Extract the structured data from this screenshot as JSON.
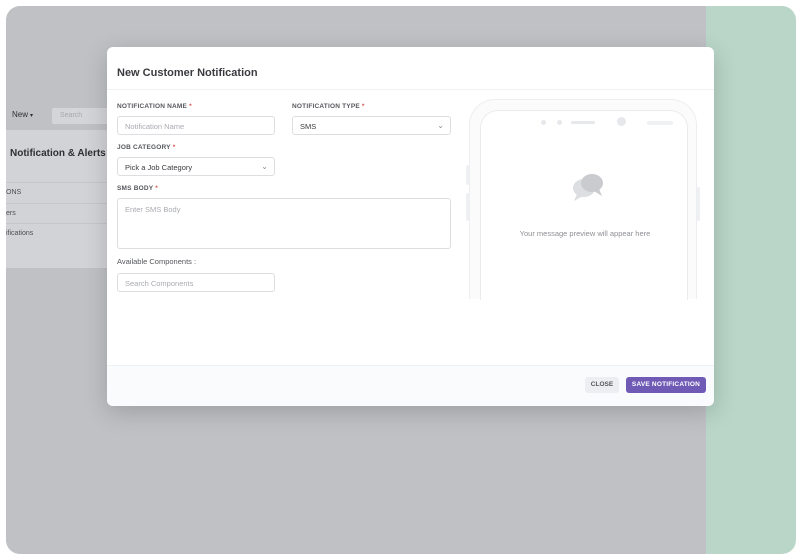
{
  "background_app": {
    "new_button": "New",
    "search_placeholder": "Search",
    "page_title": "Notification & Alerts",
    "menu_items": [
      "ONS",
      "ers",
      "ifications"
    ]
  },
  "modal": {
    "title": "New Customer Notification",
    "notification_name": {
      "label": "NOTIFICATION NAME",
      "required_mark": "*",
      "placeholder": "Notification Name"
    },
    "notification_type": {
      "label": "NOTIFICATION TYPE",
      "required_mark": "*",
      "value": "SMS"
    },
    "job_category": {
      "label": "JOB CATEGORY",
      "required_mark": "*",
      "value": "Pick a Job Category"
    },
    "sms_body": {
      "label": "SMS BODY",
      "required_mark": "*",
      "placeholder": "Enter SMS Body"
    },
    "components": {
      "label": "Available Components :",
      "placeholder": "Search Components"
    },
    "preview": {
      "message": "Your message preview will appear here"
    },
    "footer": {
      "close_label": "CLOSE",
      "save_label": "SAVE NOTIFICATION"
    }
  },
  "colors": {
    "frame_background": "#b9d6c8",
    "primary_button": "#6f5bb6",
    "overlay_dim": "#bfc1c4",
    "required_marker": "#d9534f"
  },
  "icons": {
    "chevron": "chevron-down-icon",
    "preview": "chat-bubbles-icon",
    "new_caret": "caret-down-icon"
  }
}
